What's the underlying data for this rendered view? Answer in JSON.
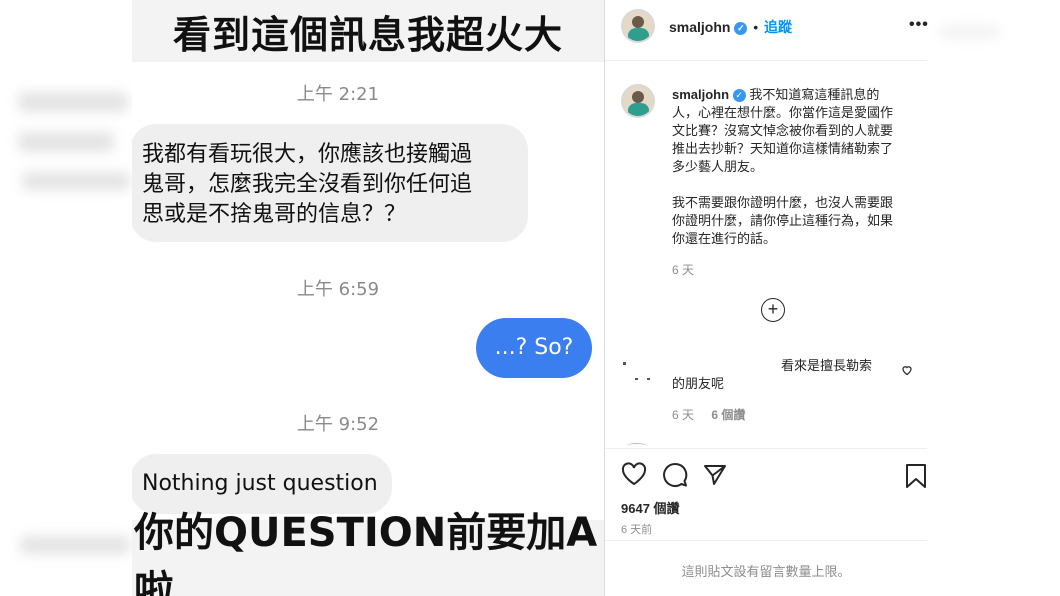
{
  "chat": {
    "banner_top": "看到這個訊息我超火大",
    "banner_bottom": "你的QUESTION前要加A啦",
    "messages": [
      {
        "time": "上午 2:21",
        "text_lines": [
          "我都有看玩很大，你應該也接觸過",
          "鬼哥，怎麼我完全沒看到你任何追",
          "思或是不捨鬼哥的信息？？"
        ],
        "direction": "incoming"
      },
      {
        "time": "上午 6:59",
        "text": "...? So?",
        "direction": "outgoing"
      },
      {
        "time": "上午 9:52",
        "text": "Nothing just question",
        "direction": "incoming"
      }
    ],
    "colors": {
      "outgoing_bubble": "#3b7ef0",
      "incoming_bubble": "#efefef"
    }
  },
  "post": {
    "header": {
      "username": "smaljohn",
      "separator": "•",
      "follow_label": "追蹤",
      "more_icon": "more-icon"
    },
    "caption": {
      "username": "smaljohn",
      "paragraph1_lines": [
        "我不知道寫這種訊息的",
        "人，心裡在想什麼。你當作這是愛國作",
        "文比賽？沒寫文悼念被你看到的人就要",
        "推出去抄斬？天知道你這樣情緒勒索了",
        "多少藝人朋友。"
      ],
      "paragraph2_lines": [
        "我不需要跟你證明什麼，也沒人需要跟",
        "你證明什麼，請你停止這種行為，如果",
        "你還在進行的話。"
      ],
      "age": "6 天"
    },
    "comment": {
      "text_line1": "看來是擅長勒索",
      "text_line2": "的朋友呢",
      "age": "6 天",
      "likes": "6 個讚"
    },
    "actions": {
      "like_icon": "heart-icon",
      "comment_icon": "comment-icon",
      "share_icon": "share-icon",
      "save_icon": "bookmark-icon"
    },
    "like_count": "9647 個讚",
    "posted_age": "6 天前",
    "comments_limited": "這則貼文設有留言數量上限。",
    "colors": {
      "link": "#0095f6",
      "muted": "#8e8e8e",
      "verified": "#3897f0"
    }
  }
}
